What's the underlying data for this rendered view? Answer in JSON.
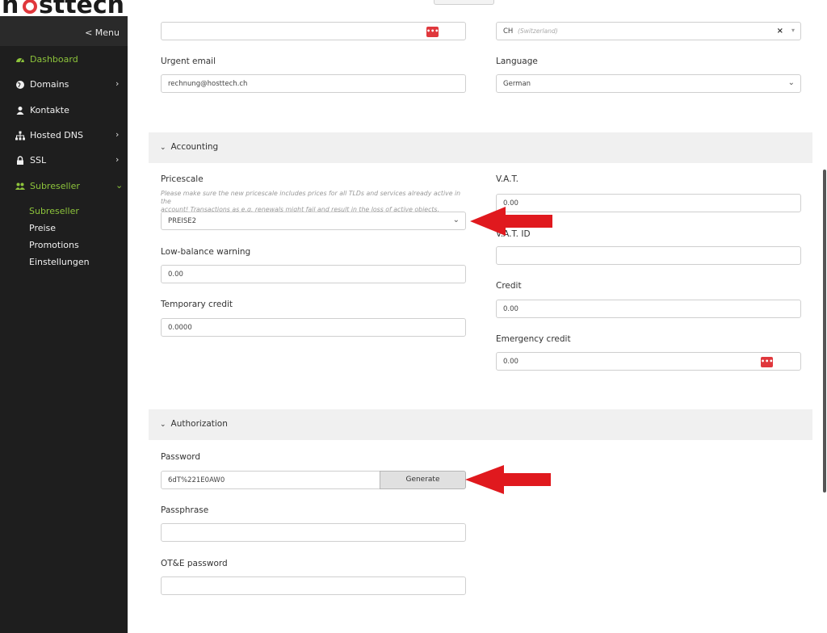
{
  "brand": {
    "logo_text": "hosttech"
  },
  "sidebar": {
    "menu_toggle": "< Menu",
    "items": [
      {
        "label": "Dashboard",
        "icon": "dashboard-icon",
        "active": true,
        "has_children": false
      },
      {
        "label": "Domains",
        "icon": "globe-icon",
        "active": false,
        "has_children": true
      },
      {
        "label": "Kontakte",
        "icon": "user-icon",
        "active": false,
        "has_children": false
      },
      {
        "label": "Hosted DNS",
        "icon": "sitemap-icon",
        "active": false,
        "has_children": true
      },
      {
        "label": "SSL",
        "icon": "lock-icon",
        "active": false,
        "has_children": true
      },
      {
        "label": "Subreseller",
        "icon": "users-icon",
        "active": true,
        "has_children": true,
        "expanded": true
      }
    ],
    "submenu": [
      "Subreseller",
      "Preise",
      "Promotions",
      "Einstellungen"
    ],
    "active_submenu": "Subreseller"
  },
  "contact": {
    "top_input_value": "",
    "country_value": "CH",
    "country_hint": "(Switzerland)",
    "country_clear": "×",
    "urgent_email_label": "Urgent email",
    "urgent_email_value": "rechnung@hosttech.ch",
    "language_label": "Language",
    "language_value": "German"
  },
  "accounting": {
    "title": "Accounting",
    "pricescale_label": "Pricescale",
    "pricescale_help_1": "Please make sure the new pricescale includes prices for all TLDs and services already active in the",
    "pricescale_help_2": "account! Transactions as e.g. renewals might fail and result in the loss of active objects.",
    "pricescale_value": "PREISE2",
    "vat_label": "V.A.T.",
    "vat_value": "0.00",
    "vat_id_label": "V.A.T. ID",
    "vat_id_value": "",
    "low_balance_label": "Low-balance warning",
    "low_balance_value": "0.00",
    "credit_label": "Credit",
    "credit_value": "0.00",
    "temporary_credit_label": "Temporary credit",
    "temporary_credit_value": "0.0000",
    "emergency_credit_label": "Emergency credit",
    "emergency_credit_value": "0.00"
  },
  "authorization": {
    "title": "Authorization",
    "password_label": "Password",
    "password_value": "6dT%221E0AW0",
    "generate_label": "Generate",
    "passphrase_label": "Passphrase",
    "passphrase_value": "",
    "ote_password_label": "OT&E password",
    "ote_password_value": ""
  },
  "colors": {
    "sidebar_bg": "#1e1e1e",
    "accent_green": "#8dc43b",
    "annotation_arrow": "#e0191e",
    "dots_button": "#e0373c"
  }
}
